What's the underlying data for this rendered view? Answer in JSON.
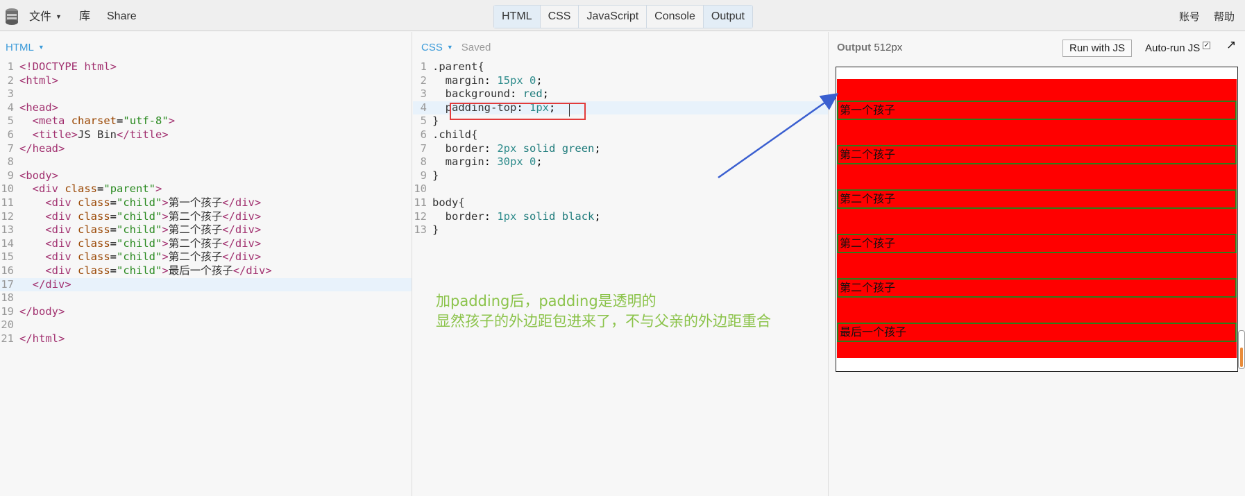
{
  "topbar": {
    "menu": [
      "文件",
      "库",
      "Share"
    ],
    "tabs": [
      {
        "label": "HTML",
        "active": true
      },
      {
        "label": "CSS",
        "active": false
      },
      {
        "label": "JavaScript",
        "active": false
      },
      {
        "label": "Console",
        "active": false
      },
      {
        "label": "Output",
        "active": true
      }
    ],
    "right": [
      "账号",
      "帮助"
    ]
  },
  "html_panel": {
    "title": "HTML",
    "lines": [
      "<!DOCTYPE html>",
      "<html>",
      "",
      "<head>",
      "  <meta charset=\"utf-8\">",
      "  <title>JS Bin</title>",
      "</head>",
      "",
      "<body>",
      "  <div class=\"parent\">",
      "    <div class=\"child\">第一个孩子</div>",
      "    <div class=\"child\">第二个孩子</div>",
      "    <div class=\"child\">第二个孩子</div>",
      "    <div class=\"child\">第二个孩子</div>",
      "    <div class=\"child\">第二个孩子</div>",
      "    <div class=\"child\">最后一个孩子</div>",
      "  </div>",
      "",
      "</body>",
      "",
      "</html>"
    ],
    "highlight_line": 17
  },
  "css_panel": {
    "title": "CSS",
    "status": "Saved",
    "lines": [
      ".parent{",
      "  margin: 15px 0;",
      "  background: red;",
      "  padding-top: 1px;",
      "}",
      ".child{",
      "  border: 2px solid green;",
      "  margin: 30px 0;",
      "}",
      "",
      "body{",
      "  border: 1px solid black;",
      "}"
    ],
    "highlight_line": 4
  },
  "annotation": {
    "line1": "加padding后，padding是透明的",
    "line2": "显然孩子的外边距包进来了，不与父亲的外边距重合",
    "color": "#8bc34a"
  },
  "output_panel": {
    "title": "Output",
    "width_label": "512px",
    "run_button": "Run with JS",
    "autorun_label": "Auto-run JS",
    "autorun_checked": true,
    "children": [
      "第一个孩子",
      "第二个孩子",
      "第二个孩子",
      "第二个孩子",
      "第二个孩子",
      "最后一个孩子"
    ]
  },
  "colors": {
    "accent": "#3a9ad9",
    "parent_bg": "#ff0000",
    "child_border": "#2e7d1b",
    "highlight_box": "#e23b3b",
    "arrow": "#3a5fd0"
  }
}
